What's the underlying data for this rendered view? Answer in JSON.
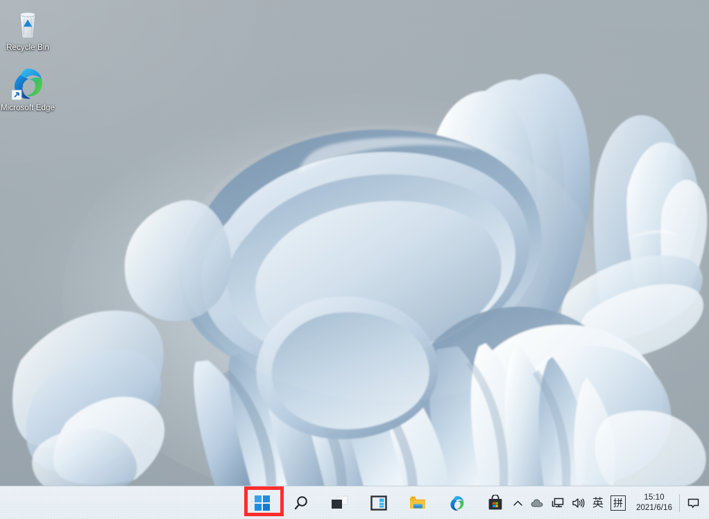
{
  "desktop": {
    "wallpaper_name": "Windows 11 Bloom",
    "background_color": "#a3acb2",
    "icons": [
      {
        "id": "recycle-bin",
        "label": "Recycle Bin",
        "icon": "recycle-bin-icon",
        "has_shortcut_arrow": false
      },
      {
        "id": "microsoft-edge",
        "label": "Microsoft Edge",
        "icon": "edge-icon",
        "has_shortcut_arrow": true
      }
    ]
  },
  "taskbar": {
    "background_color": "#eef4f8",
    "alignment": "center",
    "buttons": [
      {
        "id": "start",
        "label": "Start",
        "icon": "windows-logo-icon",
        "highlighted": true
      },
      {
        "id": "search",
        "label": "Search",
        "icon": "search-icon",
        "highlighted": false
      },
      {
        "id": "task-view",
        "label": "Task View",
        "icon": "task-view-icon",
        "highlighted": false
      },
      {
        "id": "widgets",
        "label": "Widgets",
        "icon": "widgets-icon",
        "highlighted": false
      },
      {
        "id": "file-explorer",
        "label": "File Explorer",
        "icon": "folder-icon",
        "highlighted": false
      },
      {
        "id": "edge",
        "label": "Microsoft Edge",
        "icon": "edge-icon",
        "highlighted": false
      },
      {
        "id": "store",
        "label": "Microsoft Store",
        "icon": "store-bag-icon",
        "highlighted": false
      }
    ],
    "highlight": {
      "color": "#ff2d2d",
      "target": "start",
      "border_width": 5
    },
    "tray": {
      "items": [
        {
          "id": "show-hidden",
          "label": "Show hidden icons",
          "icon": "chevron-up-icon"
        },
        {
          "id": "onedrive",
          "label": "OneDrive",
          "icon": "cloud-icon"
        },
        {
          "id": "network",
          "label": "Network",
          "icon": "network-monitor-icon"
        },
        {
          "id": "volume",
          "label": "Volume",
          "icon": "speaker-icon"
        },
        {
          "id": "ime-language",
          "label": "英",
          "icon": "ime-language-indicator"
        },
        {
          "id": "ime-mode",
          "label": "拼",
          "icon": "ime-pinyin-indicator"
        }
      ],
      "clock": {
        "time": "15:10",
        "date": "2021/6/16"
      },
      "notification": {
        "id": "notification-center",
        "label": "Notifications",
        "icon": "chat-bubble-icon"
      }
    }
  }
}
